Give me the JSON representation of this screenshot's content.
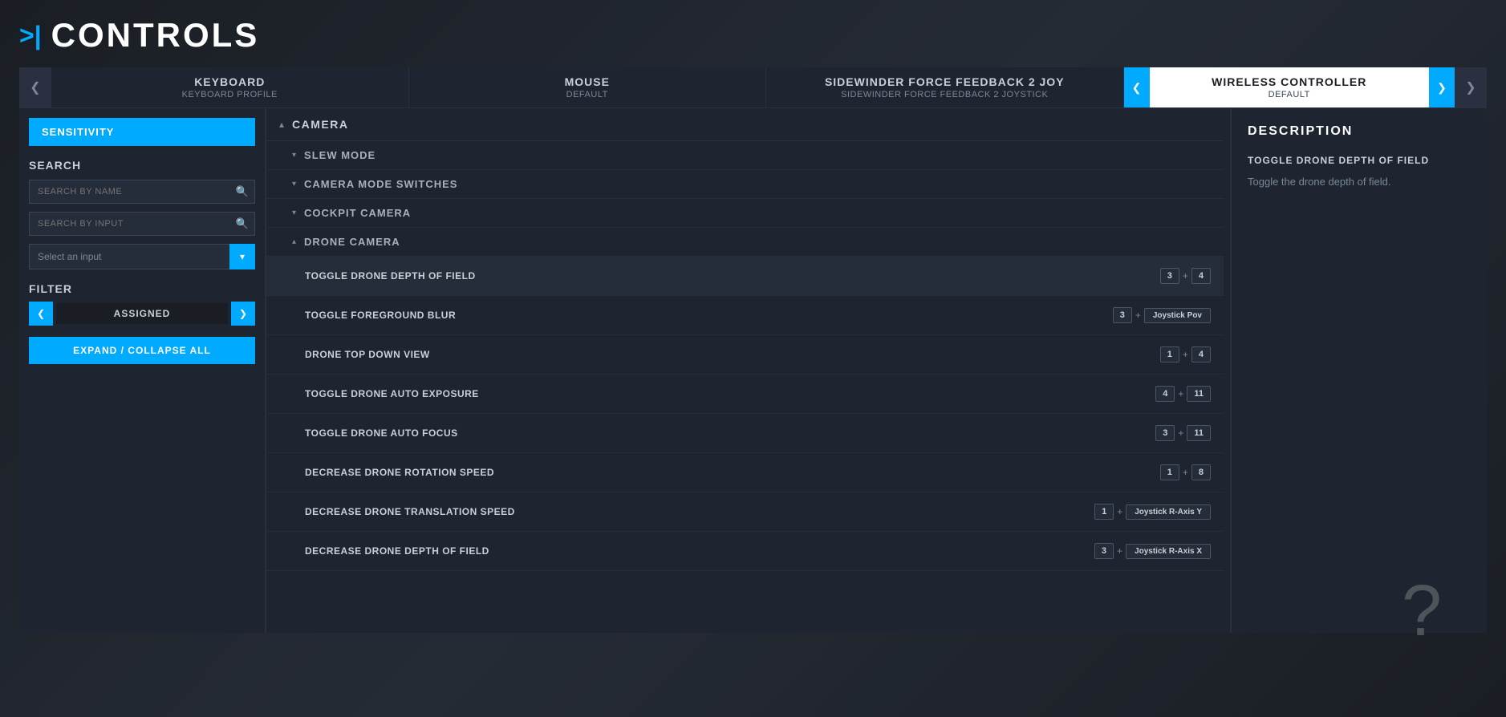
{
  "page": {
    "title": "CONTROLS",
    "title_icon": ">|"
  },
  "tabs": [
    {
      "id": "keyboard",
      "name": "KEYBOARD",
      "profile": "KEYBOARD PROFILE",
      "active": false
    },
    {
      "id": "mouse",
      "name": "MOUSE",
      "profile": "DEFAULT",
      "active": false
    },
    {
      "id": "sidewinder",
      "name": "SIDEWINDER FORCE FEEDBACK 2 JOY",
      "profile": "SIDEWINDER FORCE FEEDBACK 2 JOYSTICK",
      "active": false
    },
    {
      "id": "wireless",
      "name": "WIRELESS CONTROLLER",
      "profile": "DEFAULT",
      "active": true
    }
  ],
  "sidebar": {
    "sensitivity_label": "SENSITIVITY",
    "search_label": "SEARCH",
    "search_by_name_placeholder": "SEARCH BY NAME",
    "search_by_input_placeholder": "SEARCH BY INPUT",
    "select_input_placeholder": "Select an input",
    "filter_label": "FILTER",
    "filter_value": "ASSIGNED",
    "expand_collapse_label": "EXPAND / COLLAPSE ALL"
  },
  "categories": [
    {
      "id": "camera",
      "name": "CAMERA",
      "expanded": true,
      "subcategories": [
        {
          "id": "slew-mode",
          "name": "SLEW MODE",
          "expanded": false,
          "actions": []
        },
        {
          "id": "camera-mode-switches",
          "name": "CAMERA MODE SWITCHES",
          "expanded": false,
          "actions": []
        },
        {
          "id": "cockpit-camera",
          "name": "COCKPIT CAMERA",
          "expanded": false,
          "actions": []
        },
        {
          "id": "drone-camera",
          "name": "DRONE CAMERA",
          "expanded": true,
          "actions": [
            {
              "id": "toggle-drone-dof",
              "name": "TOGGLE DRONE DEPTH OF FIELD",
              "bindings": [
                {
                  "key": "3",
                  "separator": "+",
                  "key2": "4"
                }
              ],
              "selected": true
            },
            {
              "id": "toggle-foreground-blur",
              "name": "TOGGLE FOREGROUND BLUR",
              "bindings": [
                {
                  "key": "3",
                  "separator": "+",
                  "key2": "Joystick Pov",
                  "key2_wide": true
                }
              ]
            },
            {
              "id": "drone-top-down-view",
              "name": "DRONE TOP DOWN VIEW",
              "bindings": [
                {
                  "key": "1",
                  "separator": "+",
                  "key2": "4"
                }
              ]
            },
            {
              "id": "toggle-drone-auto-exposure",
              "name": "TOGGLE DRONE AUTO EXPOSURE",
              "bindings": [
                {
                  "key": "4",
                  "separator": "+",
                  "key2": "11"
                }
              ]
            },
            {
              "id": "toggle-drone-auto-focus",
              "name": "TOGGLE DRONE AUTO FOCUS",
              "bindings": [
                {
                  "key": "3",
                  "separator": "+",
                  "key2": "11"
                }
              ]
            },
            {
              "id": "decrease-drone-rotation-speed",
              "name": "DECREASE DRONE ROTATION SPEED",
              "bindings": [
                {
                  "key": "1",
                  "separator": "+",
                  "key2": "8"
                }
              ]
            },
            {
              "id": "decrease-drone-translation-speed",
              "name": "DECREASE DRONE TRANSLATION SPEED",
              "bindings": [
                {
                  "key": "1",
                  "separator": "+",
                  "key2": "Joystick R-Axis Y",
                  "key2_wide": true
                }
              ]
            },
            {
              "id": "decrease-drone-depth-of-field",
              "name": "DECREASE DRONE DEPTH OF FIELD",
              "bindings": [
                {
                  "key": "3",
                  "separator": "+",
                  "key2": "Joystick R-Axis X",
                  "key2_wide": true
                }
              ]
            }
          ]
        }
      ]
    }
  ],
  "description": {
    "title": "DESCRIPTION",
    "action_name": "TOGGLE DRONE DEPTH OF FIELD",
    "text": "Toggle the drone depth of field."
  },
  "icons": {
    "chevron_right": "❯",
    "chevron_left": "❮",
    "chevron_down": "▾",
    "chevron_up": "▴",
    "search": "🔍",
    "expand_arrow": "▾"
  },
  "colors": {
    "accent": "#00aaff",
    "bg_dark": "#1a1e24",
    "bg_medium": "#1e2530",
    "text_primary": "#ffffff",
    "text_secondary": "#c8d0d8",
    "text_muted": "#7a8898"
  }
}
